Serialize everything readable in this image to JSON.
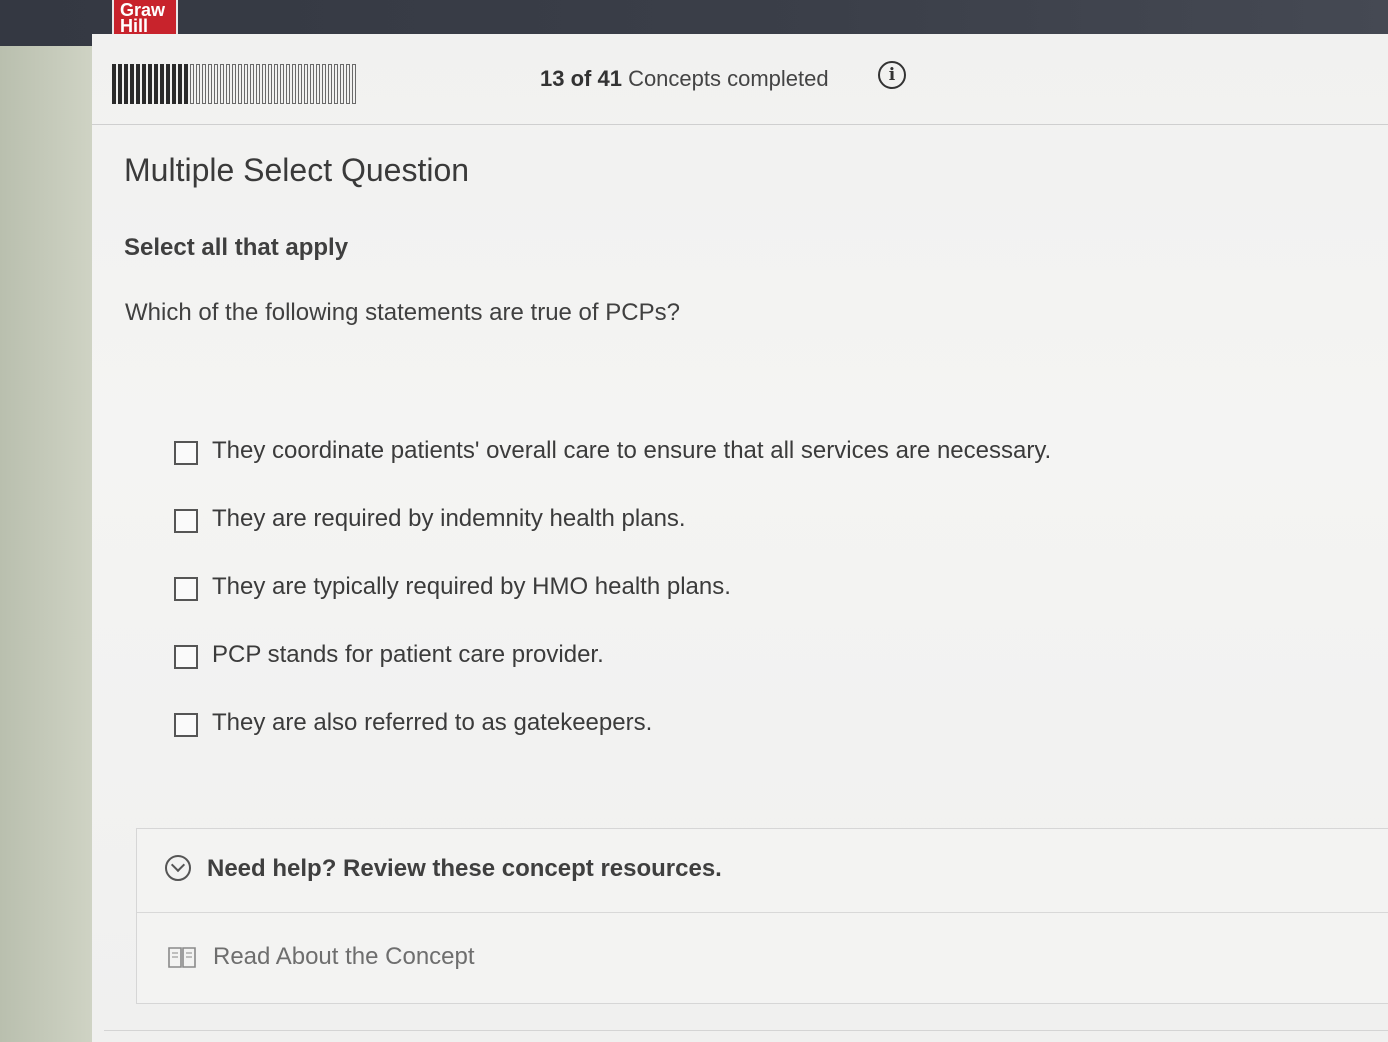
{
  "header": {
    "logo_line1": "Graw",
    "logo_line2": "Hill"
  },
  "progress": {
    "completed": 13,
    "total": 41,
    "count_text": "13 of 41",
    "label": "Concepts completed",
    "info_icon": "info-icon"
  },
  "question": {
    "type": "Multiple Select Question",
    "instruction": "Select all that apply",
    "text": "Which of the following statements are true of PCPs?",
    "options": [
      {
        "label": "They coordinate patients' overall care to ensure that all services are necessary.",
        "checked": false
      },
      {
        "label": "They are required by indemnity health plans.",
        "checked": false
      },
      {
        "label": "They are typically required by HMO health plans.",
        "checked": false
      },
      {
        "label": "PCP stands for patient care provider.",
        "checked": false
      },
      {
        "label": "They are also referred to as gatekeepers.",
        "checked": false
      }
    ]
  },
  "help": {
    "title": "Need help? Review these concept resources.",
    "toggle_icon": "chevron-down-icon",
    "resource_label": "Read About the Concept",
    "resource_icon": "book-icon"
  },
  "colors": {
    "topbar": "#3b3f49",
    "logo_red": "#c8232c",
    "panel": "#f2f2f1"
  }
}
